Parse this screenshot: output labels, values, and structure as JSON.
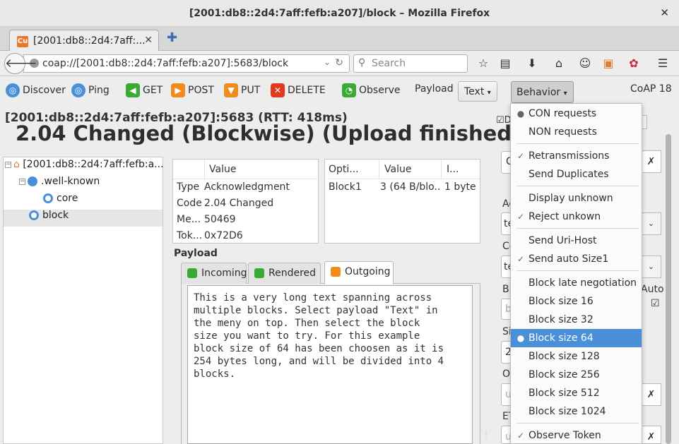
{
  "window": {
    "title": "[2001:db8::2d4:7aff:fefb:a207]/block – Mozilla Firefox"
  },
  "tab": {
    "label": "[2001:db8::2d4:7aff:..."
  },
  "navbar": {
    "url": "coap://[2001:db8::2d4:7aff:fefb:a207]:5683/block",
    "search_placeholder": "Search"
  },
  "toolbar": {
    "discover": "Discover",
    "ping": "Ping",
    "get": "GET",
    "post": "POST",
    "put": "PUT",
    "delete": "DELETE",
    "observe": "Observe",
    "payload": "Payload",
    "payload_format": "Text",
    "behavior": "Behavior",
    "coap_version": "CoAP 18"
  },
  "status": {
    "line": "[2001:db8::2d4:7aff:fefb:a207]:5683 (RTT: 418ms)",
    "code": "2.04 Changed (Blockwise) (Upload finished)"
  },
  "tree": {
    "root": "[2001:db8::2d4:7aff:fefb:a...",
    "well_known": ".well-known",
    "core": "core",
    "block": "block"
  },
  "header_table": {
    "col_value": "Value",
    "rows": [
      {
        "key": "Type",
        "value": "Acknowledgment"
      },
      {
        "key": "Code",
        "value": "2.04 Changed"
      },
      {
        "key": "Me...",
        "value": "50469"
      },
      {
        "key": "Tok...",
        "value": "0x72D6"
      }
    ]
  },
  "options_table": {
    "col_option": "Opti...",
    "col_value": "Value",
    "col_info": "I...",
    "rows": [
      {
        "option": "Block1",
        "value": "3 (64 B/blo...",
        "info": "1 byte"
      }
    ]
  },
  "payload": {
    "label": "Payload",
    "tabs": [
      "Incoming",
      "Rendered",
      "Outgoing"
    ],
    "outgoing_text": "This is a very long text spanning across\nmultiple blocks. Select payload \"Text\" in\nthe meny on top. Then select the block\nsize you want to try. For this example\nblock size of 64 has been choosen as it is\n254 bytes long, and will be divided into 4\nblocks."
  },
  "right_fragments": {
    "ac": "Ac",
    "te1": "te",
    "co": "Co",
    "te2": "te",
    "bl": "Bl",
    "b": "b",
    "auto": "Auto",
    "si": "Si",
    "z": "2",
    "o": "O",
    "u1": "u",
    "et": "ET",
    "u2": "u",
    "d": "D",
    "c": "C"
  },
  "behavior_menu": {
    "items": [
      {
        "label": "CON requests",
        "mark": "●"
      },
      {
        "label": "NON requests",
        "mark": ""
      },
      {
        "label": "Retransmissions",
        "mark": "✓"
      },
      {
        "label": "Send Duplicates",
        "mark": ""
      },
      {
        "label": "Display unknown",
        "mark": ""
      },
      {
        "label": "Reject unkown",
        "mark": "✓"
      },
      {
        "label": "Send Uri-Host",
        "mark": ""
      },
      {
        "label": "Send auto Size1",
        "mark": "✓"
      },
      {
        "label": "Block late negotiation",
        "mark": ""
      },
      {
        "label": "Block size 16",
        "mark": ""
      },
      {
        "label": "Block size 32",
        "mark": ""
      },
      {
        "label": "Block size 64",
        "mark": "●"
      },
      {
        "label": "Block size 128",
        "mark": ""
      },
      {
        "label": "Block size 256",
        "mark": ""
      },
      {
        "label": "Block size 512",
        "mark": ""
      },
      {
        "label": "Block size 1024",
        "mark": ""
      },
      {
        "label": "Observe Token",
        "mark": "✓"
      }
    ]
  },
  "colors": {
    "selected": "#4a90d9",
    "get": "#3aa935",
    "post": "#f08c1c",
    "delete": "#e03b1f",
    "discover": "#4a90d9",
    "observe": "#3aa935"
  }
}
